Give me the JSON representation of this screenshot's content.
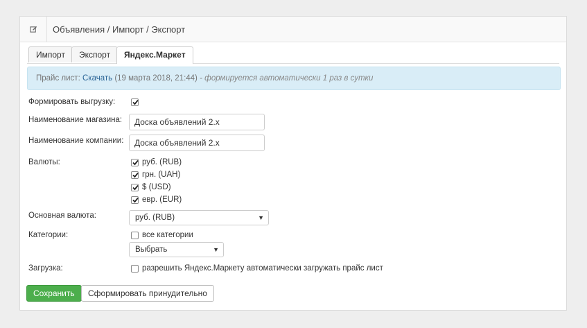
{
  "header": {
    "title": "Объявления / Импорт / Экспорт",
    "icon": "edit-icon"
  },
  "tabs": [
    {
      "label": "Импорт"
    },
    {
      "label": "Экспорт"
    },
    {
      "label": "Яндекс.Маркет",
      "active": true
    }
  ],
  "alert": {
    "prefix": "Прайс лист:",
    "link": "Скачать",
    "date": "(19 марта 2018, 21:44)",
    "note": "- формируется автоматически 1 раз в сутки"
  },
  "form": {
    "export_label": "Формировать выгрузку:",
    "export_checked": true,
    "shop_name_label": "Наименование магазина:",
    "shop_name_value": "Доска объявлений 2.x",
    "company_name_label": "Наименование компании:",
    "company_name_value": "Доска объявлений 2.x",
    "currencies_label": "Валюты:",
    "currencies": [
      {
        "label": "руб. (RUB)",
        "checked": true
      },
      {
        "label": "грн. (UAH)",
        "checked": true
      },
      {
        "label": "$ (USD)",
        "checked": true
      },
      {
        "label": "евр. (EUR)",
        "checked": true
      }
    ],
    "main_currency_label": "Основная валюта:",
    "main_currency_value": "руб. (RUB)",
    "categories_label": "Категории:",
    "all_categories_label": "все категории",
    "all_categories_checked": false,
    "categories_select_value": "Выбрать",
    "upload_label": "Загрузка:",
    "upload_checkbox_label": "разрешить Яндекс.Маркету автоматически загружать прайс лист",
    "upload_checked": false
  },
  "buttons": {
    "save": "Сохранить",
    "force": "Сформировать принудительно"
  }
}
